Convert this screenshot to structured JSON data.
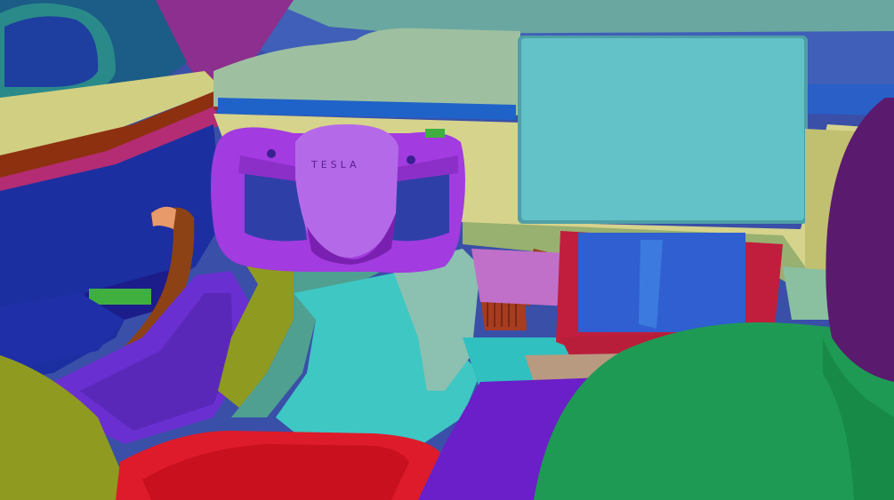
{
  "scene": {
    "description_type": "segmentation-style rendering of a car interior",
    "steering_wheel_brand": "TESLA"
  },
  "colors": {
    "steering_wheel": "#a23be0",
    "center_screen": "#62c2c8",
    "dashboard": "#d6d38c",
    "driver_seat": "#de1b2a",
    "passenger_seat": "#1f9a55",
    "door_panel": "#1c2fa0",
    "floor": "#3fc7c4",
    "console_screen": "#2f5fd0"
  }
}
